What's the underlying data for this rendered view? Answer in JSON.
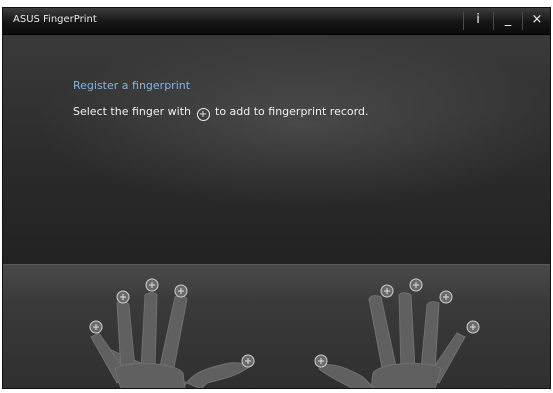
{
  "window": {
    "title": "ASUS FingerPrint"
  },
  "titlebar": {
    "info_symbol": "i",
    "minimize_symbol": "_",
    "close_symbol": "×"
  },
  "main": {
    "heading": "Register a fingerprint",
    "instruction_before": "Select the finger with",
    "instruction_symbol": "⊕",
    "instruction_after": "to add to fingerprint record."
  },
  "hands": {
    "finger_symbol": "⊕",
    "left_fingers": [
      "little",
      "ring",
      "middle",
      "index",
      "thumb"
    ],
    "right_fingers": [
      "thumb",
      "index",
      "middle",
      "ring",
      "little"
    ]
  },
  "colors": {
    "heading": "#7fb4e6",
    "hand": "#606060"
  }
}
